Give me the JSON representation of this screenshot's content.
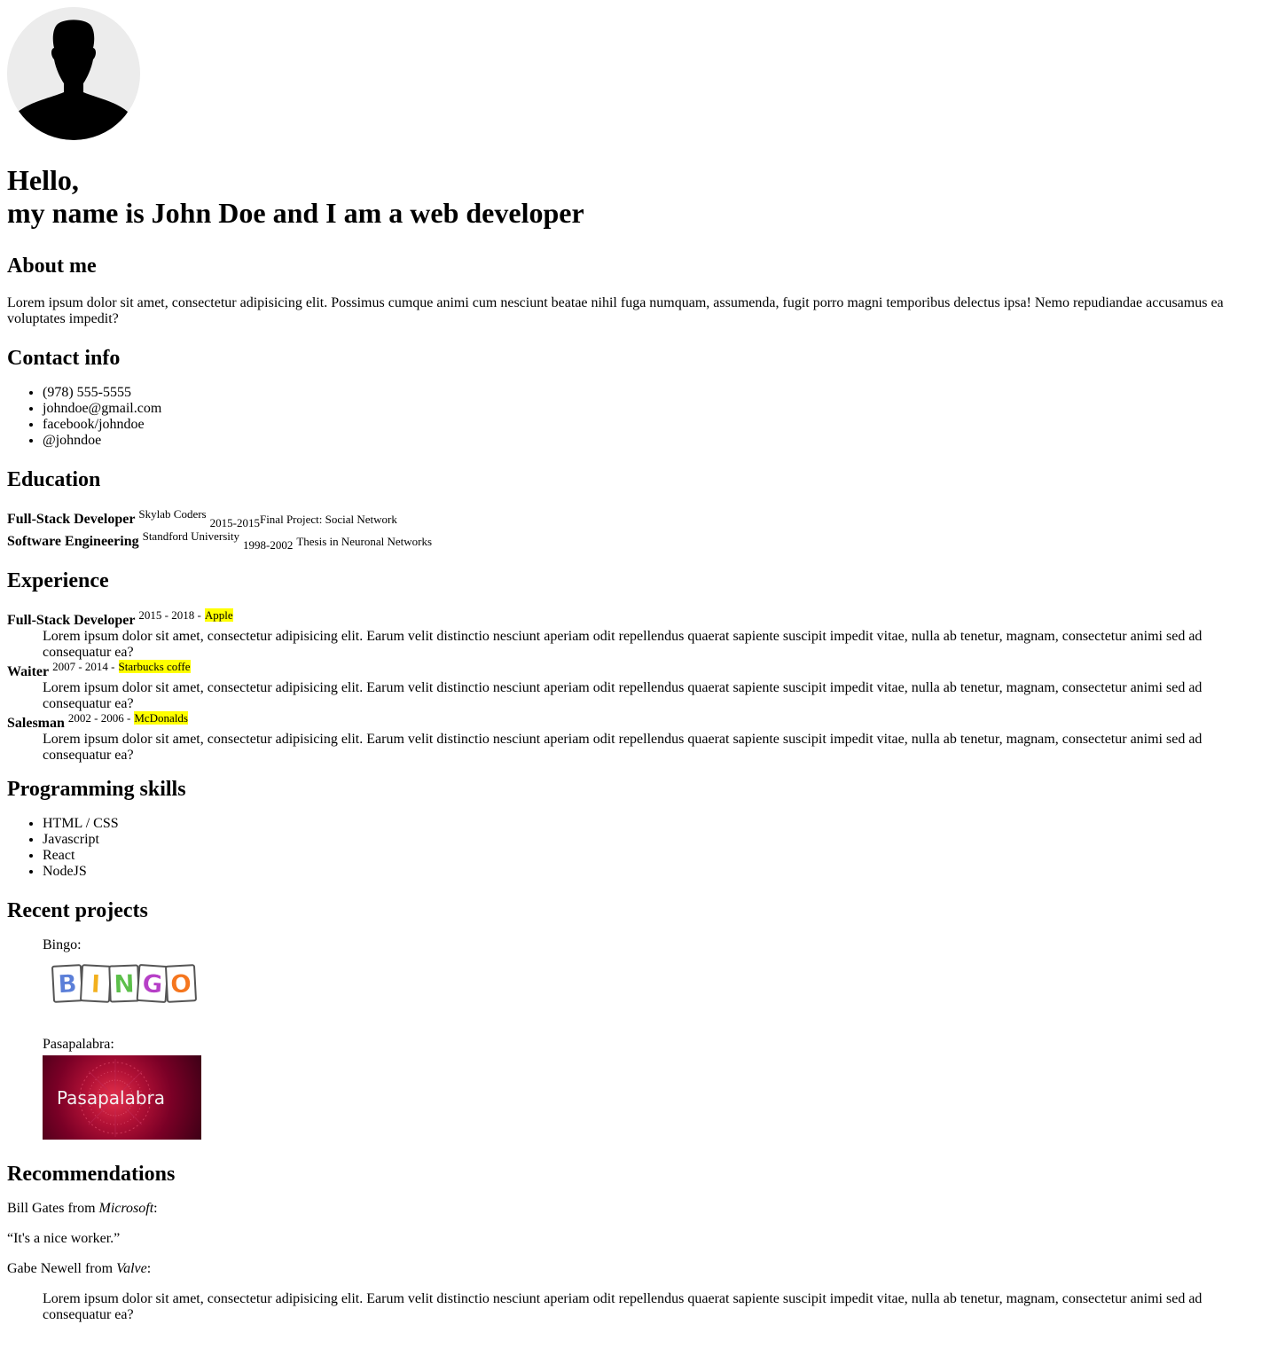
{
  "hero": {
    "line1": "Hello,",
    "line2": "my name is John Doe and I am a web developer"
  },
  "about": {
    "heading": "About me",
    "text": "Lorem ipsum dolor sit amet, consectetur adipisicing elit. Possimus cumque animi cum nesciunt beatae nihil fuga numquam, assumenda, fugit porro magni temporibus delectus ipsa! Nemo repudiandae accusamus ea voluptates impedit?"
  },
  "contact": {
    "heading": "Contact info",
    "items": [
      "(978) 555-5555",
      "johndoe@gmail.com",
      "facebook/johndoe",
      "@johndoe"
    ]
  },
  "education": {
    "heading": "Education",
    "items": [
      {
        "title": "Full-Stack Developer",
        "school": "Skylab Coders",
        "years": "2015-2015",
        "note": "Final Project: Social Network"
      },
      {
        "title": "Software Engineering",
        "school": "Standford University",
        "years": "1998-2002",
        "note": "Thesis in Neuronal Networks"
      }
    ]
  },
  "experience": {
    "heading": "Experience",
    "items": [
      {
        "title": "Full-Stack Developer",
        "dates": "2015 - 2018 -",
        "company": "Apple",
        "desc": "Lorem ipsum dolor sit amet, consectetur adipisicing elit. Earum velit distinctio nesciunt aperiam odit repellendus quaerat sapiente suscipit impedit vitae, nulla ab tenetur, magnam, consectetur animi sed ad consequatur ea?"
      },
      {
        "title": "Waiter",
        "dates": "2007 - 2014 -",
        "company": "Starbucks coffe",
        "desc": "Lorem ipsum dolor sit amet, consectetur adipisicing elit. Earum velit distinctio nesciunt aperiam odit repellendus quaerat sapiente suscipit impedit vitae, nulla ab tenetur, magnam, consectetur animi sed ad consequatur ea?"
      },
      {
        "title": "Salesman",
        "dates": "2002 - 2006 -",
        "company": "McDonalds",
        "desc": "Lorem ipsum dolor sit amet, consectetur adipisicing elit. Earum velit distinctio nesciunt aperiam odit repellendus quaerat sapiente suscipit impedit vitae, nulla ab tenetur, magnam, consectetur animi sed ad consequatur ea?"
      }
    ],
    "highlight_color": "#ffff00"
  },
  "skills": {
    "heading": "Programming skills",
    "items": [
      "HTML / CSS",
      "Javascript",
      "React",
      "NodeJS"
    ]
  },
  "projects": {
    "heading": "Recent projects",
    "items": [
      {
        "label": "Bingo:",
        "image_text": "BINGO",
        "letters": [
          "B",
          "I",
          "N",
          "G",
          "O"
        ],
        "letter_colors": [
          "#5b7fd8",
          "#f2b01e",
          "#5cbf4a",
          "#b63fc7",
          "#f5761e"
        ]
      },
      {
        "label": "Pasapalabra:",
        "image_text": "Pasapalabra"
      }
    ]
  },
  "recommendations": {
    "heading": "Recommendations",
    "rec1_name": "Bill Gates from ",
    "rec1_company": "Microsoft",
    "rec1_colon": ":",
    "rec1_quote": "“It's a nice worker.”",
    "rec2_name": "Gabe Newell from ",
    "rec2_company": "Valve",
    "rec2_colon": ":",
    "rec2_quote": "Lorem ipsum dolor sit amet, consectetur adipisicing elit. Earum velit distinctio nesciunt aperiam odit repellendus quaerat sapiente suscipit impedit vitae, nulla ab tenetur, magnam, consectetur animi sed ad consequatur ea?"
  }
}
